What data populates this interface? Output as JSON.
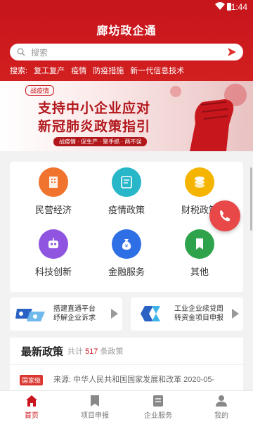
{
  "status": {
    "time": "1:44"
  },
  "header": {
    "title": "廊坊政企通",
    "search_placeholder": "搜索",
    "hot_prefix": "搜索:",
    "hot_terms": [
      "复工复产",
      "疫情",
      "防疫措施",
      "新一代信息技术"
    ]
  },
  "banner": {
    "tag": "战疫情",
    "line1": "支持中小企业应对",
    "line2": "新冠肺炎政策指引",
    "subtitle": "战疫情 · 促生产 · 聚手抓 · 两不误"
  },
  "grid": {
    "items": [
      {
        "label": "民营经济",
        "icon": "building-icon",
        "color": "#f0732e"
      },
      {
        "label": "疫情政策",
        "icon": "document-icon",
        "color": "#27b7c9"
      },
      {
        "label": "财税政策",
        "icon": "coins-icon",
        "color": "#f4b400"
      },
      {
        "label": "科技创新",
        "icon": "robot-icon",
        "color": "#8f55e0"
      },
      {
        "label": "金融服务",
        "icon": "money-bag-icon",
        "color": "#2f6fe6"
      },
      {
        "label": "其他",
        "icon": "bookmark-icon",
        "color": "#2fa34b"
      }
    ]
  },
  "cards": [
    {
      "line1": "搭建直通平台",
      "line2": "纾解企业诉求",
      "icon": "platform-icon"
    },
    {
      "line1": "工业企业续贷周",
      "line2": "转资金项目申报",
      "icon": "loop-icon"
    }
  ],
  "news": {
    "title": "最新政策",
    "count_prefix": "共计",
    "count": "517",
    "count_suffix": "条政策",
    "badge": "国家级",
    "source": "来源:  中华人民共和国国家发展和改革  2020-05-"
  },
  "tabs": [
    {
      "label": "首页",
      "icon": "home-icon",
      "active": true
    },
    {
      "label": "项目申报",
      "icon": "bookmark-icon",
      "active": false
    },
    {
      "label": "企业服务",
      "icon": "list-icon",
      "active": false
    },
    {
      "label": "我的",
      "icon": "user-icon",
      "active": false
    }
  ],
  "colors": {
    "brand": "#c8161d",
    "call": "#e84848"
  }
}
